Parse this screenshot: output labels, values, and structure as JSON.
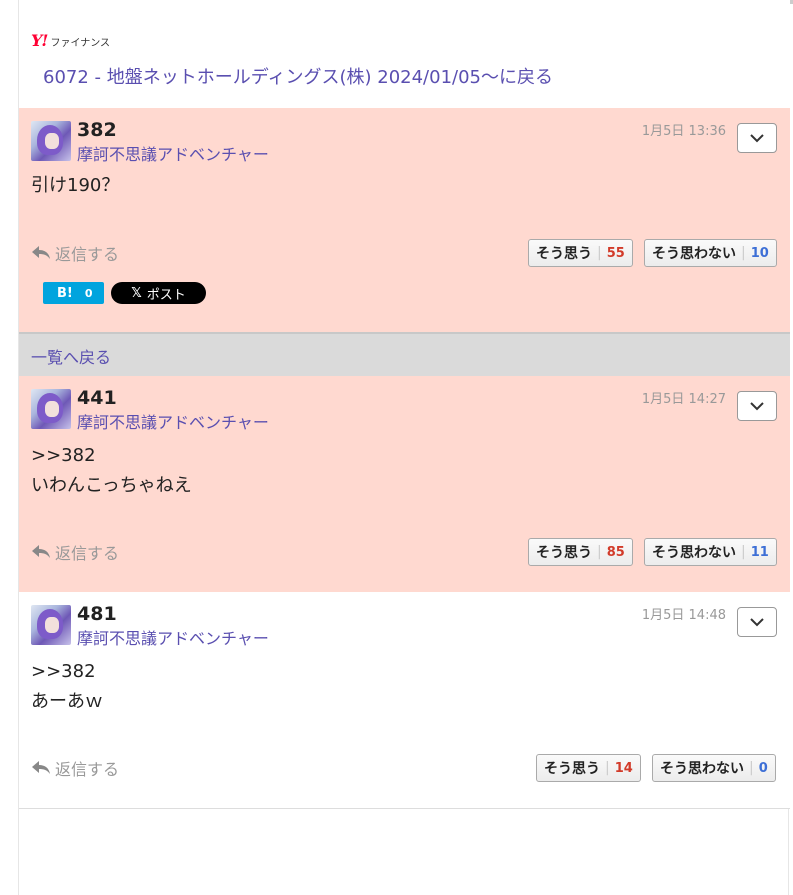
{
  "header": {
    "logo_mark": "Y!",
    "logo_text": "ファイナンス",
    "board_title": "6072 - 地盤ネットホールディングス(株) 2024/01/05〜に戻る"
  },
  "reply_label": "返信する",
  "agree_label": "そう思う",
  "disagree_label": "そう思わない",
  "back_to_list": "一覧へ戻る",
  "posts": [
    {
      "number": "382",
      "author": "摩訶不思議アドベンチャー",
      "date": "1月5日 13:36",
      "lines": [
        "引け190？"
      ],
      "agree": "55",
      "disagree": "10"
    },
    {
      "number": "441",
      "author": "摩訶不思議アドベンチャー",
      "date": "1月5日 14:27",
      "lines": [
        ">>382",
        "いわんこっちゃねえ"
      ],
      "agree": "85",
      "disagree": "11"
    },
    {
      "number": "481",
      "author": "摩訶不思議アドベンチャー",
      "date": "1月5日 14:48",
      "lines": [
        ">>382",
        "あーあｗ"
      ],
      "agree": "14",
      "disagree": "0"
    }
  ],
  "share": {
    "hatena_label": "B!",
    "hatena_count": "0",
    "x_icon": "𝕏",
    "x_label": "ポスト"
  },
  "colors": {
    "highlight_bg": "#ffd9d0",
    "link": "#5a4fb0",
    "agree_count": "#d23b2a",
    "disagree_count": "#3d6fd6"
  }
}
